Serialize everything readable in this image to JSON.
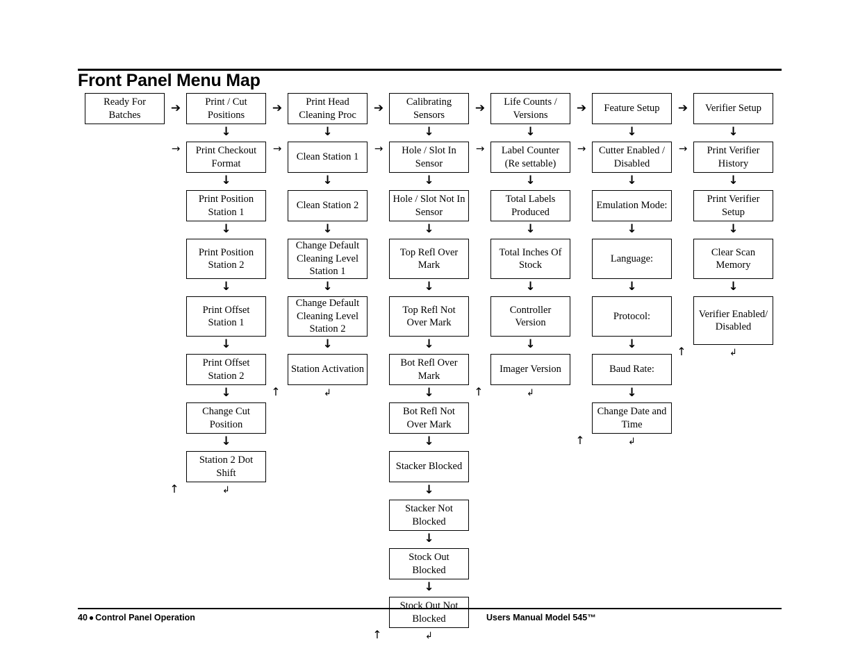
{
  "page": {
    "title": "Front Panel Menu Map",
    "footer_left_page": "40",
    "footer_left_sep": "●",
    "footer_left_section": "Control Panel Operation",
    "footer_right": "Users Manual Model 545™"
  },
  "glyphs": {
    "arrow_down": "↓",
    "arrow_right_bold": "➔",
    "arrow_right_thin": "→",
    "arrow_up": "↑",
    "return": "↲"
  },
  "columns": [
    {
      "id": "ready-for-batches",
      "nodes": [
        {
          "label": "Ready For Batches"
        }
      ]
    },
    {
      "id": "print-cut-positions",
      "nodes": [
        {
          "label": "Print / Cut Positions"
        },
        {
          "label": "Print Checkout Format"
        },
        {
          "label": "Print Position Station 1"
        },
        {
          "label": "Print Position Station 2"
        },
        {
          "label": "Print Offset Station 1"
        },
        {
          "label": "Print Offset Station 2"
        },
        {
          "label": "Change Cut Position"
        },
        {
          "label": "Station 2 Dot Shift"
        }
      ]
    },
    {
      "id": "print-head-cleaning-proc",
      "nodes": [
        {
          "label": "Print Head Cleaning Proc"
        },
        {
          "label": "Clean Station 1"
        },
        {
          "label": "Clean Station 2"
        },
        {
          "label": "Change Default Cleaning Level Station 1"
        },
        {
          "label": "Change Default Cleaning Level Station 2"
        },
        {
          "label": "Station Activation"
        }
      ]
    },
    {
      "id": "calibrating-sensors",
      "nodes": [
        {
          "label": "Calibrating Sensors"
        },
        {
          "label": "Hole / Slot In Sensor"
        },
        {
          "label": "Hole / Slot Not In Sensor"
        },
        {
          "label": "Top Refl Over Mark"
        },
        {
          "label": "Top Refl Not Over Mark"
        },
        {
          "label": "Bot Refl Over Mark"
        },
        {
          "label": "Bot Refl Not Over Mark"
        },
        {
          "label": "Stacker Blocked"
        },
        {
          "label": "Stacker Not Blocked"
        },
        {
          "label": "Stock Out Blocked"
        },
        {
          "label": "Stock Out Not Blocked"
        }
      ]
    },
    {
      "id": "life-counts-versions",
      "nodes": [
        {
          "label": "Life Counts / Versions"
        },
        {
          "label": "Label Counter (Re settable)"
        },
        {
          "label": "Total Labels Produced"
        },
        {
          "label": "Total Inches Of Stock"
        },
        {
          "label": "Controller Version"
        },
        {
          "label": "Imager Version"
        }
      ]
    },
    {
      "id": "feature-setup",
      "nodes": [
        {
          "label": "Feature Setup"
        },
        {
          "label": "Cutter Enabled / Disabled"
        },
        {
          "label": "Emulation Mode:"
        },
        {
          "label": "Language:"
        },
        {
          "label": "Protocol:"
        },
        {
          "label": "Baud Rate:"
        },
        {
          "label": "Change Date and Time"
        }
      ]
    },
    {
      "id": "verifier-setup",
      "nodes": [
        {
          "label": "Verifier Setup"
        },
        {
          "label": "Print Verifier History"
        },
        {
          "label": "Print Verifier Setup"
        },
        {
          "label": "Clear Scan Memory"
        },
        {
          "label": "Verifier Enabled/ Disabled"
        }
      ]
    }
  ]
}
